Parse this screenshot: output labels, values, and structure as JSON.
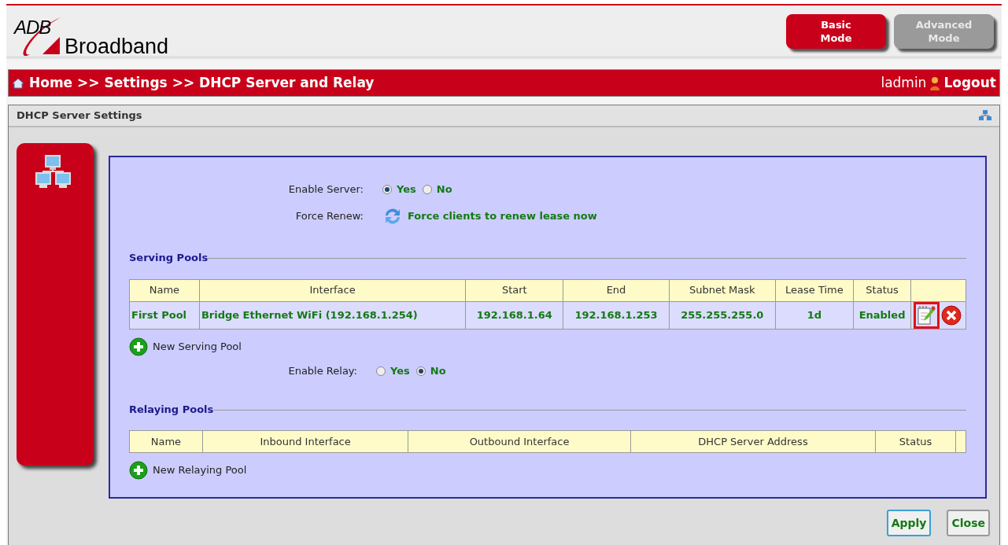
{
  "header": {
    "logo": {
      "top": "ADB",
      "bottom": "Broadband"
    },
    "modes": [
      {
        "label": "Basic\nMode",
        "selected": true
      },
      {
        "label": "Advanced\nMode",
        "selected": false
      }
    ]
  },
  "breadcrumb": {
    "path": "Home >> Settings >> DHCP Server and Relay",
    "user": "ladmin",
    "logout": "Logout"
  },
  "panel": {
    "title": "DHCP Server Settings"
  },
  "enable_server": {
    "label": "Enable Server:",
    "options": [
      {
        "label": "Yes",
        "selected": true
      },
      {
        "label": "No",
        "selected": false
      }
    ]
  },
  "force_renew": {
    "label": "Force Renew:",
    "link": "Force clients to renew lease now"
  },
  "serving_pools": {
    "title": "Serving Pools",
    "columns": [
      "Name",
      "Interface",
      "Start",
      "End",
      "Subnet Mask",
      "Lease Time",
      "Status"
    ],
    "rows": [
      {
        "cells": [
          "First Pool",
          "Bridge Ethernet WiFi (192.168.1.254)",
          "192.168.1.64",
          "192.168.1.253",
          "255.255.255.0",
          "1d",
          "Enabled"
        ],
        "edit_highlighted": true
      }
    ],
    "new_link": "New Serving Pool"
  },
  "enable_relay": {
    "label": "Enable Relay:",
    "options": [
      {
        "label": "Yes",
        "selected": false
      },
      {
        "label": "No",
        "selected": true
      }
    ]
  },
  "relaying_pools": {
    "title": "Relaying Pools",
    "columns": [
      "Name",
      "Inbound Interface",
      "Outbound Interface",
      "DHCP Server Address",
      "Status"
    ],
    "new_link": "New Relaying Pool"
  },
  "buttons": [
    "Apply",
    "Close"
  ]
}
